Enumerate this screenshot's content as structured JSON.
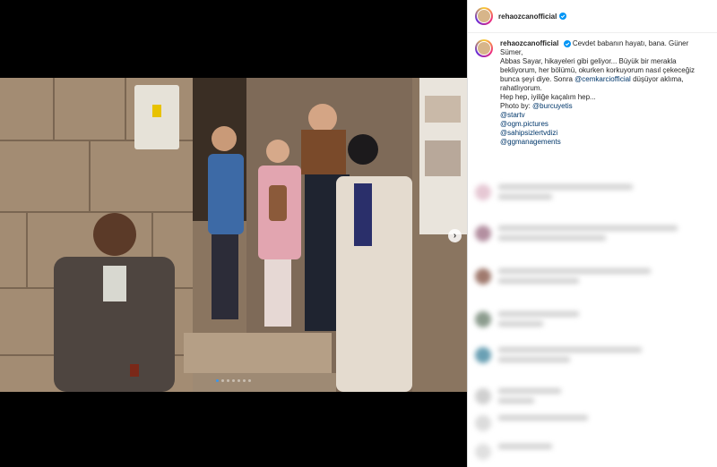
{
  "post": {
    "username": "rehaozcanofficial",
    "caption_user": "rehaozcanofficial",
    "caption_lines": [
      "Cevdet babanın hayatı, bana. Güner Sümer,",
      "Abbas Sayar, hikayeleri gibi geliyor... Büyük bir merakla",
      "bekliyorum, her bölümü, okurken korkuyorum nasıl çekeceğiz",
      "bunca şeyi diye. Sonra",
      "düşüyor aklıma,",
      "rahatlıyorum.",
      "Hep hep, iyiliğe kaçalım hep...",
      "Photo by:"
    ],
    "mention_inline": "@cemkarciofficial",
    "photo_credit": "@burcuyetis",
    "tags": [
      "@startv",
      "@ogm.pictures",
      "@sahipsizlertvdizi",
      "@ggmanagements"
    ]
  },
  "carousel": {
    "slide_count": 7,
    "active_index": 0,
    "next_icon": "chevron-right-icon"
  },
  "colors": {
    "accent_blue": "#3897f0",
    "verified_blue": "#0095f6",
    "link_blue": "#00376b"
  }
}
